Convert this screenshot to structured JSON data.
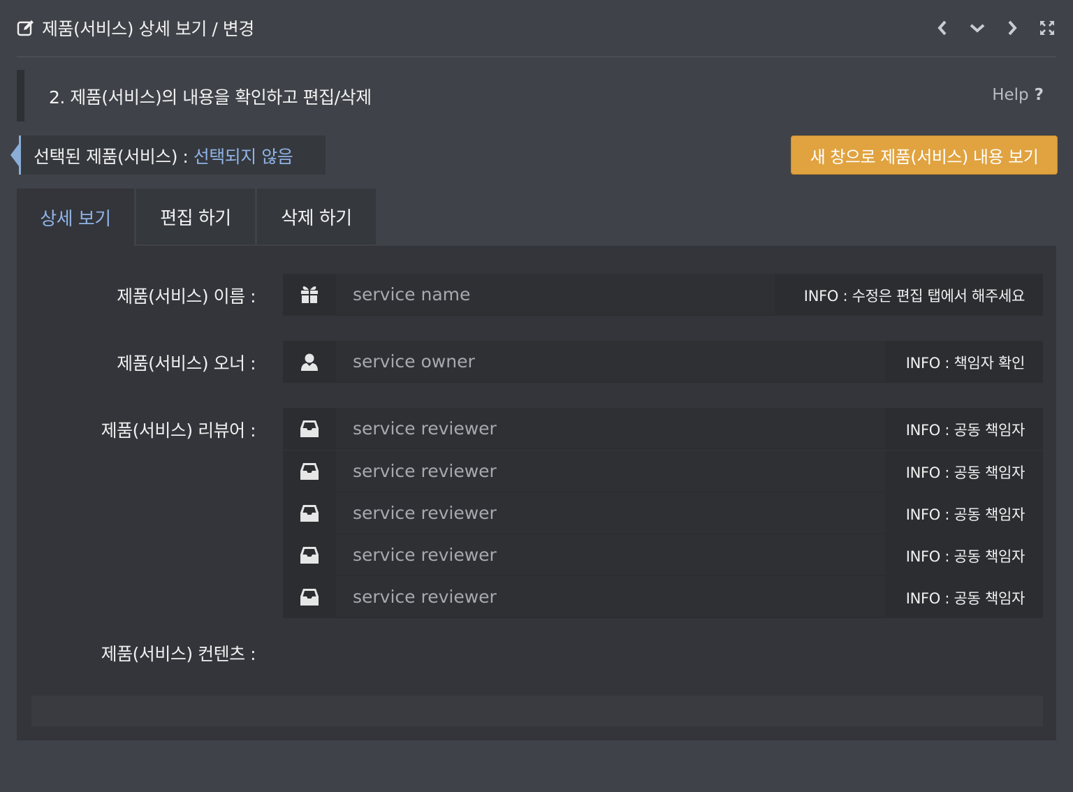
{
  "header": {
    "title": "제품(서비스) 상세 보기 / 변경",
    "icon": "edit-icon",
    "controls": [
      "chevron-left-icon",
      "chevron-down-icon",
      "chevron-right-icon",
      "fullscreen-icon"
    ]
  },
  "step": {
    "title": "2. 제품(서비스)의 내용을 확인하고 편집/삭제",
    "help_label": "Help",
    "help_icon": "?"
  },
  "selection": {
    "label": "선택된 제품(서비스) : ",
    "value": "선택되지 않음"
  },
  "new_window_button": "새 창으로 제품(서비스) 내용 보기",
  "tabs": [
    {
      "label": "상세 보기",
      "active": true
    },
    {
      "label": "편집 하기",
      "active": false
    },
    {
      "label": "삭제 하기",
      "active": false
    }
  ],
  "fields": {
    "name": {
      "label": "제품(서비스) 이름 :",
      "placeholder": "service name",
      "info": "INFO : 수정은 편집 탭에서 해주세요",
      "icon": "gift-icon"
    },
    "owner": {
      "label": "제품(서비스) 오너 :",
      "placeholder": "service owner",
      "info": "INFO : 책임자 확인",
      "icon": "user-icon"
    },
    "reviewer": {
      "label": "제품(서비스) 리뷰어 :",
      "icon": "inbox-icon",
      "rows": [
        {
          "placeholder": "service reviewer",
          "info": "INFO : 공동 책임자"
        },
        {
          "placeholder": "service reviewer",
          "info": "INFO : 공동 책임자"
        },
        {
          "placeholder": "service reviewer",
          "info": "INFO : 공동 책임자"
        },
        {
          "placeholder": "service reviewer",
          "info": "INFO : 공동 책임자"
        },
        {
          "placeholder": "service reviewer",
          "info": "INFO : 공동 책임자"
        }
      ]
    },
    "contents": {
      "label": "제품(서비스) 컨텐츠 :"
    }
  },
  "colors": {
    "accent_blue": "#8fb3e6",
    "button_orange": "#e0a340",
    "background": "#3f4248"
  }
}
